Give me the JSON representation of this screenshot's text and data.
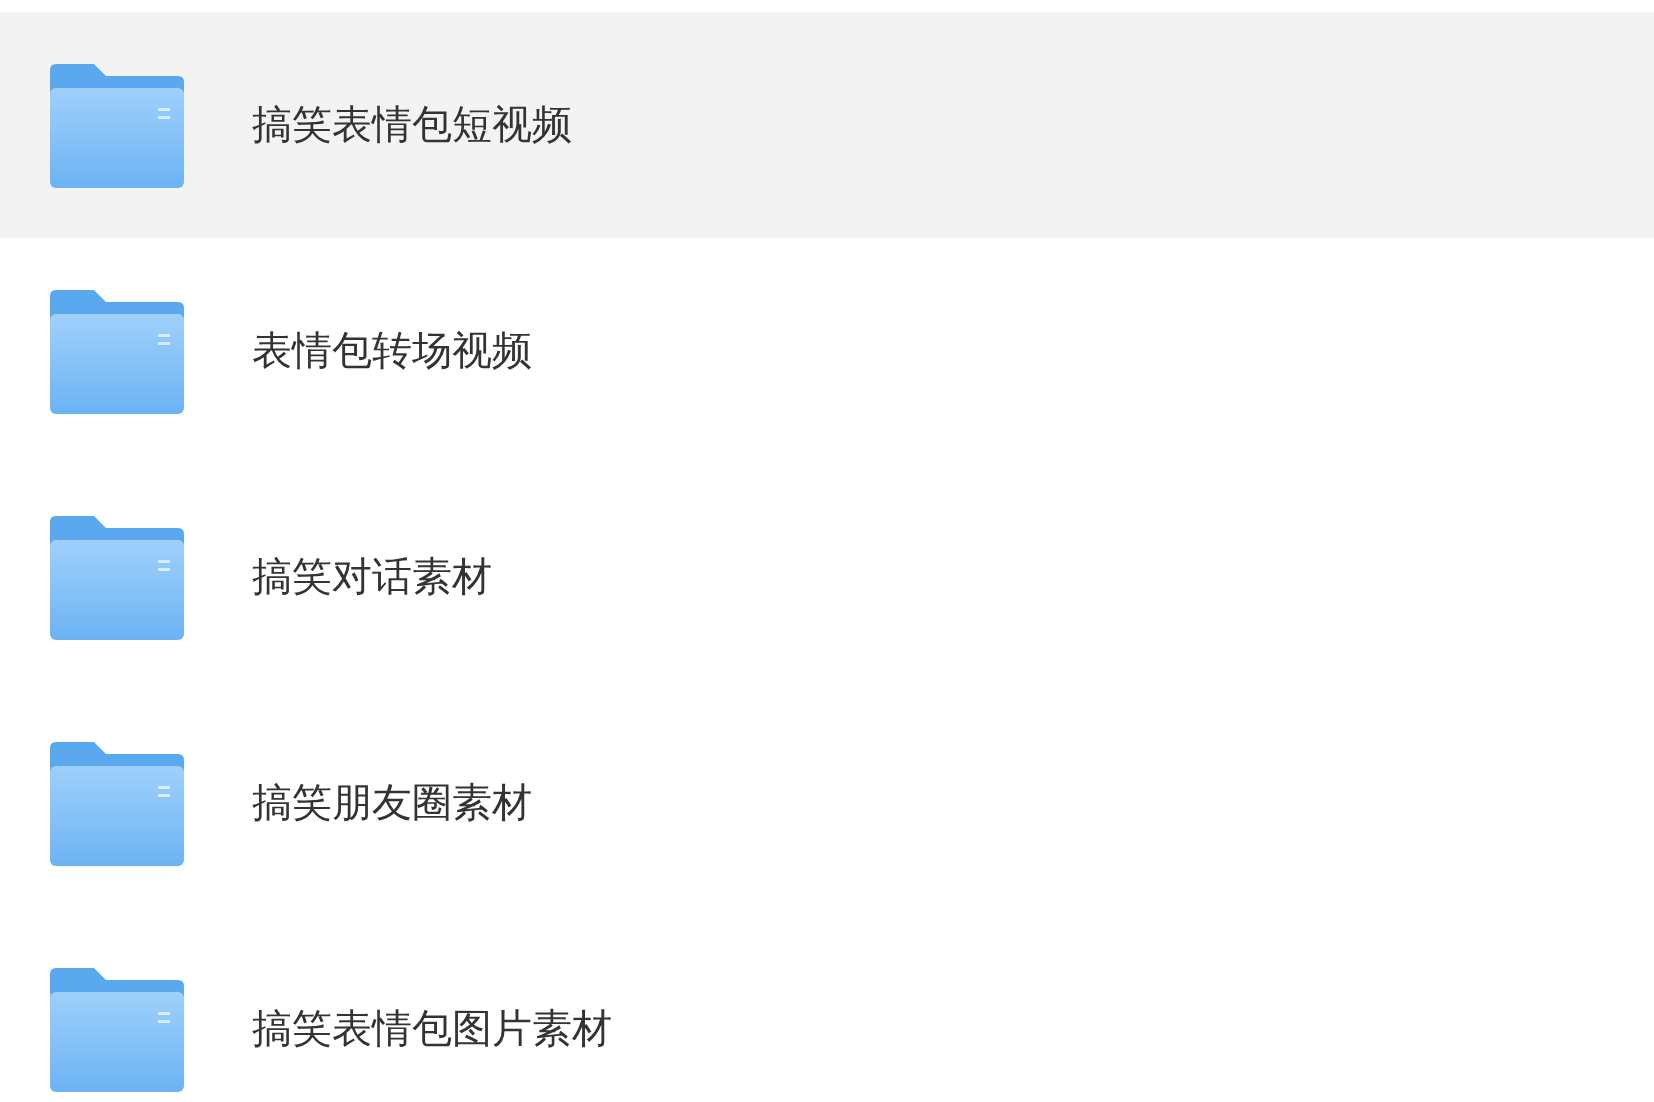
{
  "folders": [
    {
      "name": "搞笑表情包短视频",
      "selected": true
    },
    {
      "name": "表情包转场视频",
      "selected": false
    },
    {
      "name": "搞笑对话素材",
      "selected": false
    },
    {
      "name": "搞笑朋友圈素材",
      "selected": false
    },
    {
      "name": "搞笑表情包图片素材",
      "selected": false
    }
  ]
}
